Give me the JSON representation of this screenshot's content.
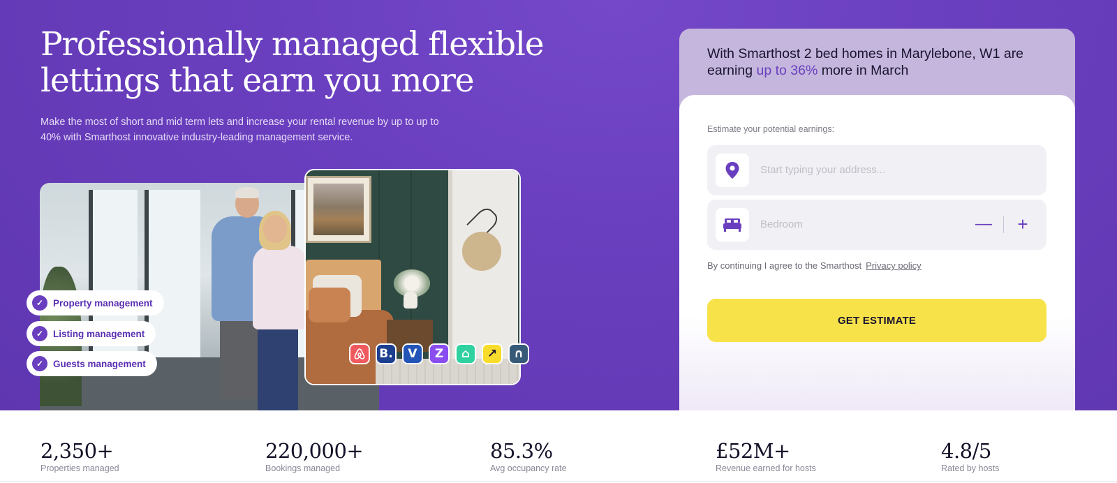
{
  "hero": {
    "title": "Professionally managed flexible lettings that earn you more",
    "subtitle": "Make the most of short and mid term lets and increase your rental revenue by up to up to 40% with Smarthost innovative industry-leading management service."
  },
  "services": [
    {
      "label": "Property management",
      "icon": "check-icon"
    },
    {
      "label": "Listing management",
      "icon": "check-icon"
    },
    {
      "label": "Guests management",
      "icon": "check-icon"
    }
  ],
  "platforms": [
    {
      "name": "airbnb-logo",
      "glyph": "",
      "color": "#f05a5e"
    },
    {
      "name": "booking-logo",
      "glyph": "B.",
      "color": "#1d3f8f"
    },
    {
      "name": "vrbo-logo",
      "glyph": "V",
      "color": "#2354b7"
    },
    {
      "name": "z-platform-logo",
      "glyph": "Z",
      "color": "#8a4df0"
    },
    {
      "name": "home-platform-logo",
      "glyph": "⌂",
      "color": "#2fd1a0"
    },
    {
      "name": "arrow-platform-logo",
      "glyph": "↗",
      "color": "#f8dc2b"
    },
    {
      "name": "n-platform-logo",
      "glyph": "∩",
      "color": "#375a78"
    }
  ],
  "estimate": {
    "headline_pre": "With Smarthost 2 bed homes in Marylebone, W1 are earning ",
    "headline_highlight": "up to 36%",
    "headline_post": " more in March",
    "label": "Estimate your potential earnings:",
    "address_placeholder": "Start typing your address...",
    "bedroom_placeholder": "Bedroom",
    "minus": "—",
    "plus": "+",
    "consent_text": "By continuing I agree to the Smarthost",
    "privacy_link": "Privacy policy",
    "cta_label": "GET ESTIMATE"
  },
  "stats": [
    {
      "value": "2,350+",
      "label": "Properties managed"
    },
    {
      "value": "220,000+",
      "label": "Bookings managed"
    },
    {
      "value": "85.3%",
      "label": "Avg occupancy rate"
    },
    {
      "value": "£52M+",
      "label": "Revenue earned for hosts"
    },
    {
      "value": "4.8/5",
      "label": "Rated by hosts"
    }
  ],
  "colors": {
    "brand_purple": "#6a3fbf",
    "cta_yellow": "#f8e24a",
    "card_top": "#c4b6dc"
  }
}
